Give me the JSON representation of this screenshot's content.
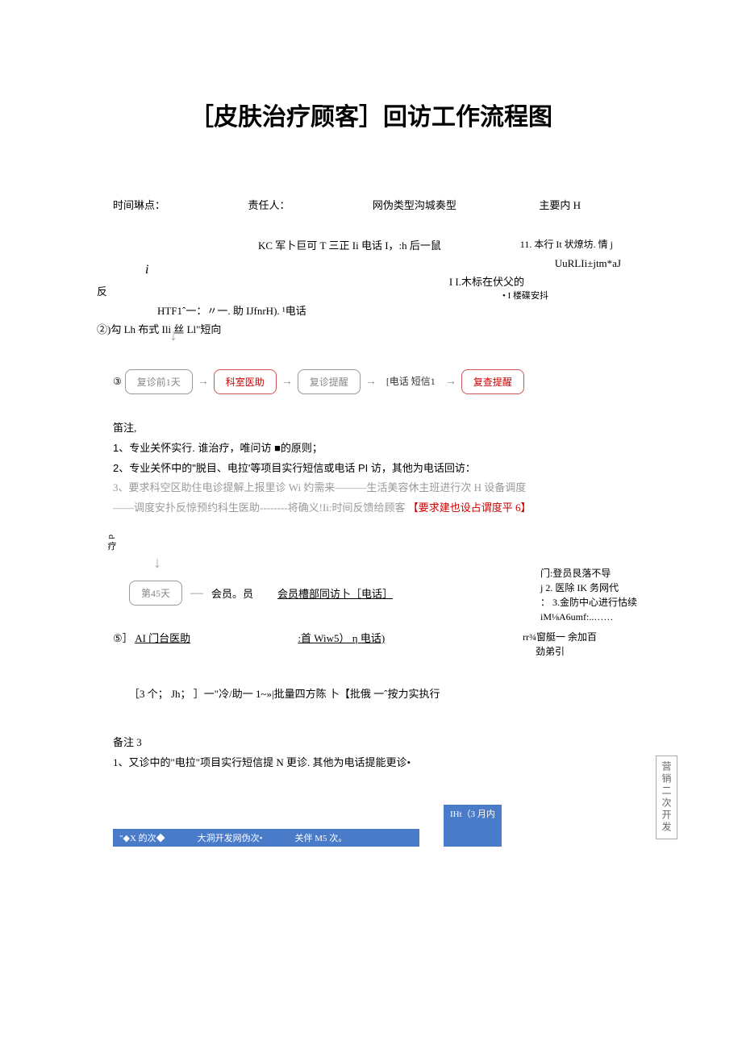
{
  "title": "［皮肤治疗顾客］回访工作流程图",
  "header": {
    "col1": "时间琳点：",
    "col2": "责任人：",
    "col3": "网伪类型沟城奏型",
    "col4": "主要内 H"
  },
  "block1": {
    "line1": "KC 军卜巨可 T 三正 Ii 电话 I，:h 后一鼠",
    "line1_right": "11. 本行 It 状燎坊. 情 j",
    "line2_i": "i",
    "line2_right": "UuRLIi±jtm*aJ",
    "line3": "反",
    "line4": "HTF1ˆ一：〃一. 助 IJfnrH). ¹电话",
    "line4_right": "I I.木标在伏父的",
    "line5": "②)勾 Lh 布式 Ili 丝 Ll\"短向",
    "line5_right": "•  I 楼碟安抖"
  },
  "flow1": {
    "num": "③",
    "box1": "复诊前1天",
    "box2": "科室医助",
    "box3": "复诊提醒",
    "label": "[电话\n短信1",
    "box4": "复查提醒"
  },
  "notes1": {
    "heading": "笛注,",
    "item1": "1、专业关怀实行. 谁治疗，唯问访 ■的原则；",
    "item2": "2、专业关怀中的\"脱目、电拉'等项目实行短信或电话 PI 访，其他为电话回访：",
    "item3_a": "3、要求科空区助住电诊提解上报里诊 Wi 妁需来———生活美容休主班进行次 H 设备调度",
    "item3_b": "——调度安扑反惊预约科生医助--------将确义!Ii:时间反馈给顾客",
    "item3_c": "【要求建也设占谓度平 6】"
  },
  "vertLabel": "d\n疗",
  "flow2": {
    "box1": "第45天",
    "label1": "会员。员",
    "label2": "会员槽部同访卜［电话］"
  },
  "rightList": {
    "r1": "门:登员艮落不导",
    "r2": "j 2. 医除 IK 务网代",
    "r3": "：  3.金防中心进行怙续",
    "r4": "iM⅛A6umf:..……"
  },
  "row5": {
    "num": "⑤］",
    "left": "AI 门台医助",
    "mid": ":首 Wiw5）  η 电话)",
    "right1": "rr¾窗艇一  余加百",
    "right2": "劲弟引"
  },
  "row6": "［3 个；  Jh；  ］一\"冷/助一 1~»|批量四方陈 卜【批俄 一ˆ按力实执行",
  "sideBox": "营销二次开发",
  "notes3": {
    "heading": "备注 3",
    "item1": "1、又诊中的\"电拉\"项目实行短信提 N 更诊. 其他为电话提能更诊•"
  },
  "footer": {
    "c1": "\"◆X 的次◆",
    "c2": "大洞开发网伪次•",
    "c3": "关伴 M5 次。",
    "c4": "IHt（3 月内"
  }
}
